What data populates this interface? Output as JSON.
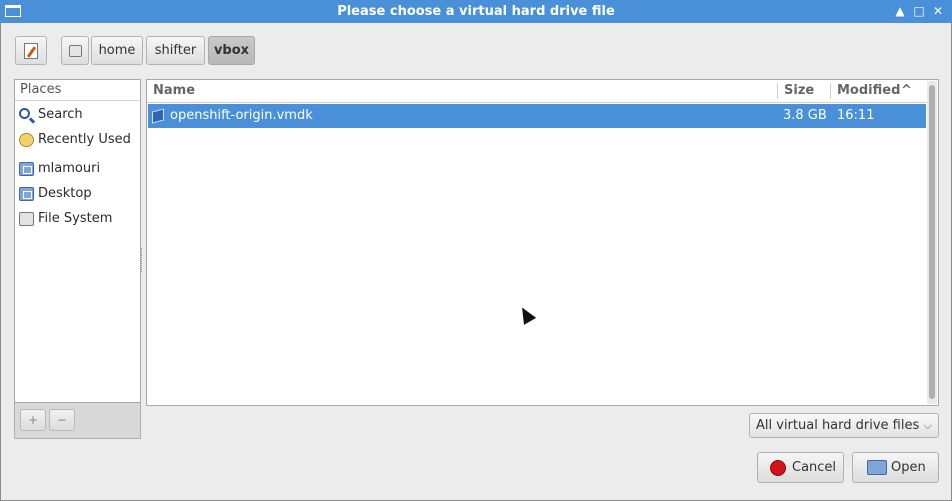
{
  "window": {
    "title": "Please choose a virtual hard drive file",
    "controls": [
      "▲",
      "□",
      "✕"
    ]
  },
  "pathbar": {
    "segments": [
      {
        "label": "home",
        "active": false
      },
      {
        "label": "shifter",
        "active": false
      },
      {
        "label": "vbox",
        "active": true
      }
    ]
  },
  "places": {
    "header": "Places",
    "items": [
      {
        "label": "Search",
        "icon": "search-icon"
      },
      {
        "label": "Recently Used",
        "icon": "recent-icon"
      },
      {
        "label": "mlamouri",
        "icon": "home-folder-icon"
      },
      {
        "label": "Desktop",
        "icon": "desktop-folder-icon"
      },
      {
        "label": "File System",
        "icon": "drive-icon"
      }
    ],
    "add_label": "+",
    "remove_label": "−"
  },
  "files": {
    "columns": {
      "name": "Name",
      "size": "Size",
      "modified": "Modified"
    },
    "sort_indicator": "^",
    "rows": [
      {
        "name": "openshift-origin.vmdk",
        "size": "3.8 GB",
        "modified": "16:11",
        "selected": true
      }
    ]
  },
  "filter": {
    "selected": "All virtual hard drive files",
    "chevron": "⌵"
  },
  "actions": {
    "cancel": "Cancel",
    "open": "Open"
  },
  "colors": {
    "accent": "#4a90d9",
    "cancel_icon": "#d4121c"
  }
}
